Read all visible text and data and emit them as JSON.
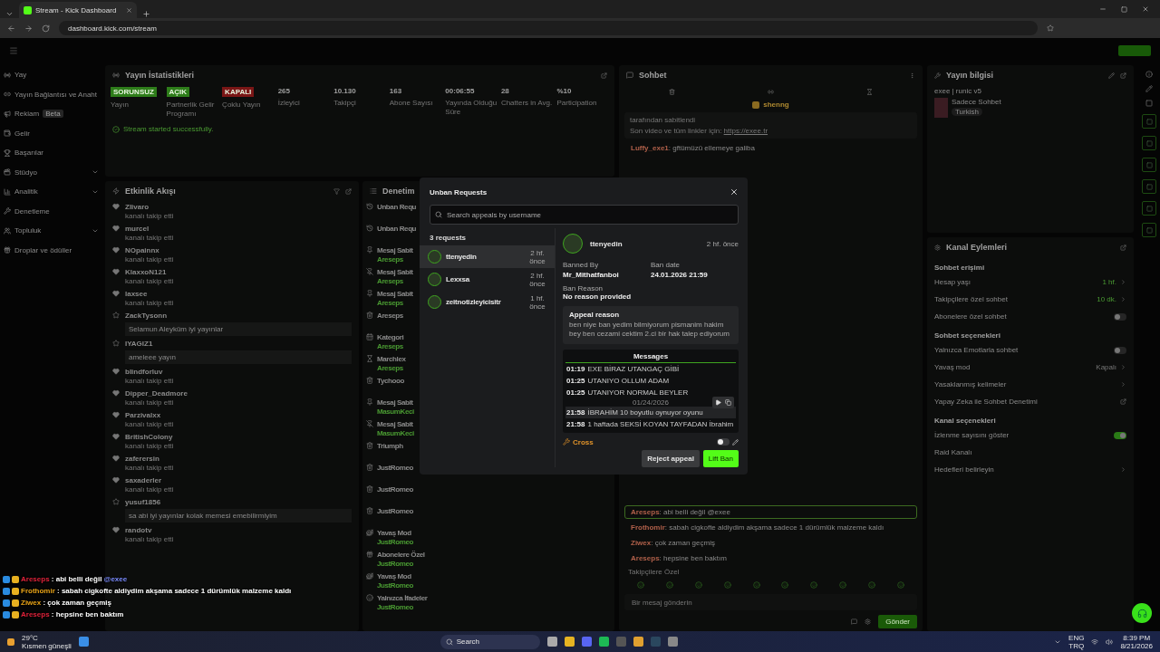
{
  "browser": {
    "tab_title": "Stream - Kick Dashboard",
    "url": "dashboard.kick.com/stream"
  },
  "sidebar": {
    "items": [
      {
        "label": "Yay",
        "submenu": false
      },
      {
        "label": "Yayın Bağlantısı ve Anaht",
        "submenu": false
      },
      {
        "label": "Rekiam",
        "badge": "Beta",
        "submenu": false
      },
      {
        "label": "Gelir",
        "submenu": false
      },
      {
        "label": "Başarılar",
        "submenu": false
      },
      {
        "label": "Stüdyo",
        "submenu": true
      },
      {
        "label": "Analitik",
        "submenu": true
      },
      {
        "label": "Denetleme",
        "submenu": false
      },
      {
        "label": "Topluluk",
        "submenu": true
      },
      {
        "label": "Droplar ve ödüller",
        "submenu": false
      }
    ]
  },
  "stats": {
    "title": "Yayın İstatistikleri",
    "items": [
      {
        "kind": "status",
        "value": "SORUNSUZ",
        "label": "Yayın",
        "color": "#2e7d1a"
      },
      {
        "kind": "status",
        "value": "AÇIK",
        "label": "Partnerlik Gelir Programı",
        "color": "#2e7d1a"
      },
      {
        "kind": "status",
        "value": "KAPALI",
        "label": "Çoklu Yayın",
        "color": "#7a1616"
      },
      {
        "kind": "metric",
        "value": "265",
        "label": "İzleyici"
      },
      {
        "kind": "metric",
        "value": "10.130",
        "label": "Takipçi"
      },
      {
        "kind": "metric",
        "value": "163",
        "label": "Abone Sayısı"
      },
      {
        "kind": "metric",
        "value": "00:06:55",
        "label": "Yayında Olduğu Süre"
      },
      {
        "kind": "metric",
        "value": "28",
        "label": "Chatters in Avg."
      },
      {
        "kind": "metric",
        "value": "%10",
        "label": "Participation"
      }
    ],
    "notice": "Stream started successfully."
  },
  "activity": {
    "title": "Etkinlik Akışı",
    "items": [
      {
        "kind": "follow",
        "name": "Zlivaro",
        "note": "kanalı takip etti"
      },
      {
        "kind": "follow",
        "name": "murcel",
        "note": "kanalı takip etti"
      },
      {
        "kind": "follow",
        "name": "NOpainnx",
        "note": "kanalı takip etti"
      },
      {
        "kind": "follow",
        "name": "KlaxxoN121",
        "note": "kanalı takip etti"
      },
      {
        "kind": "follow",
        "name": "laxsee",
        "note": "kanalı takip etti"
      },
      {
        "kind": "sub",
        "name": "ZackTysonn",
        "message": "Selamun Aleyküm iyi yayınlar"
      },
      {
        "kind": "sub",
        "name": "IYAGIZ1",
        "message": "ameleee yayın"
      },
      {
        "kind": "follow",
        "name": "blindforluv",
        "note": "kanalı takip etti"
      },
      {
        "kind": "follow",
        "name": "Dipper_Deadmore",
        "note": "kanalı takip etti"
      },
      {
        "kind": "follow",
        "name": "Parzivalxx",
        "note": "kanalı takip etti"
      },
      {
        "kind": "follow",
        "name": "BritishColony",
        "note": "kanalı takip etti"
      },
      {
        "kind": "follow",
        "name": "zaferersin",
        "note": "kanalı takip etti"
      },
      {
        "kind": "follow",
        "name": "saxaderler",
        "note": "kanalı takip etti"
      },
      {
        "kind": "sub",
        "name": "yusuf1856",
        "message": "sa abi iyi yayınlar kolak memesi emebilirmiyim"
      },
      {
        "kind": "follow",
        "name": "randotv",
        "note": "kanalı takip etti"
      }
    ]
  },
  "moderation": {
    "title": "Denetim",
    "items": [
      {
        "kind": "unban",
        "title": "Unban Requ"
      },
      {
        "kind": "unban",
        "title": "Unban Requ"
      },
      {
        "kind": "pin",
        "title": "Mesaj Sabit",
        "user": "Areseps"
      },
      {
        "kind": "unpin",
        "title": "Mesaj Sabit",
        "user": "Areseps"
      },
      {
        "kind": "pin",
        "title": "Mesaj Sabit",
        "user": "Areseps"
      },
      {
        "kind": "delete",
        "title": "Areseps"
      },
      {
        "kind": "category",
        "title": "Kategori",
        "user": "Areseps"
      },
      {
        "kind": "timeout",
        "title": "Marchlex",
        "user": "Areseps"
      },
      {
        "kind": "delete",
        "title": "Tychooo"
      },
      {
        "kind": "pin",
        "title": "Mesaj Sabit",
        "user": "MasumKeci"
      },
      {
        "kind": "unpin",
        "title": "Mesaj Sabit",
        "user": "MasumKeci"
      },
      {
        "kind": "delete",
        "title": "Triumph"
      },
      {
        "kind": "delete",
        "title": "JustRomeo"
      },
      {
        "kind": "delete",
        "title": "JustRomeo"
      },
      {
        "kind": "delete",
        "title": "JustRomeo"
      },
      {
        "kind": "slow",
        "title": "Yavaş Mod",
        "user": "JustRomeo"
      },
      {
        "kind": "subs",
        "title": "Abonelere Özel",
        "user": "JustRomeo"
      },
      {
        "kind": "slow",
        "title": "Yavaş Mod",
        "user": "JustRomeo"
      },
      {
        "kind": "emotes",
        "title": "Yalnızca İfadeler",
        "user": "JustRomeo"
      }
    ]
  },
  "chat": {
    "title": "Sohbet",
    "pinned_user": "shenng",
    "pinned_note": "tarafından sabitlendi",
    "pinned_text": "Son video ve tüm linkler için: ",
    "pinned_link": "https://exee.tr",
    "top_messages": [
      {
        "user": "Luffy_exe1",
        "text": ": gftümüzü ellemeye galiba"
      }
    ],
    "messages": [
      {
        "user": "Areseps",
        "text": ": abi belli değil @exee",
        "highlighted": true
      },
      {
        "user": "Frothomir",
        "text": ": sabah cigkofte aldiydim akşama sadece 1 dürümlük malzeme kaldı",
        "highlighted": false
      },
      {
        "user": "Ziwex",
        "text": ": çok zaman geçmiş",
        "highlighted": false
      },
      {
        "user": "Areseps",
        "text": ": hepsine ben baktım",
        "highlighted": false
      }
    ],
    "mode_note": "Takipçilere Özel",
    "placeholder": "Bir mesaj gönderin",
    "send": "Gönder"
  },
  "stream_info": {
    "title": "Yayın bilgisi",
    "stream_title": "exee | runic v5",
    "category": "Sadece Sohbet",
    "language": "Turkish"
  },
  "channel_actions": {
    "title": "Kanal Eylemleri",
    "sections": [
      {
        "title": "Sohbet erişimi",
        "rows": [
          {
            "kind": "value",
            "label": "Hesap yaşı",
            "value": "1 hf."
          },
          {
            "kind": "value",
            "label": "Takipçilere özel sohbet",
            "value": "10 dk."
          },
          {
            "kind": "toggle",
            "label": "Abonelere özel sohbet",
            "on": false
          }
        ]
      },
      {
        "title": "Sohbet seçenekleri",
        "rows": [
          {
            "kind": "toggle",
            "label": "Yalnızca Emotlarla sohbet",
            "on": false
          },
          {
            "kind": "muted",
            "label": "Yavaş mod",
            "value": "Kapalı"
          },
          {
            "kind": "link",
            "label": "Yasaklanmış kelimeler"
          },
          {
            "kind": "external",
            "label": "Yapay Zeka ile Sohbet Denetimi"
          }
        ]
      },
      {
        "title": "Kanal seçenekleri",
        "rows": [
          {
            "kind": "toggle",
            "label": "İzlenme sayısını göster",
            "on": true
          },
          {
            "kind": "plain",
            "label": "Raid Kanalı"
          },
          {
            "kind": "link",
            "label": "Hedefleri belirleyin"
          }
        ]
      }
    ]
  },
  "overlay_chat": [
    {
      "user": "Areseps",
      "color": "#e0223a",
      "text": " : abi belli değil ",
      "mention": "@exee"
    },
    {
      "user": "Frothomir",
      "color": "#e8a317",
      "text": " : sabah cigkofte aldiydim akşama sadece 1 dürümlük malzeme kaldı"
    },
    {
      "user": "Ziwex",
      "color": "#e8a317",
      "text": " : çok zaman geçmiş"
    },
    {
      "user": "Areseps",
      "color": "#e0223a",
      "text": " : hepsine ben baktım"
    }
  ],
  "modal": {
    "title": "Unban Requests",
    "search_placeholder": "Search appeals by username",
    "count": "3 requests",
    "requests": [
      {
        "name": "ttenyedin",
        "time": "2 hf. önce",
        "selected": true
      },
      {
        "name": "Lexxsa",
        "time": "2 hf. önce",
        "selected": false
      },
      {
        "name": "zeitnotizleyicisitr",
        "time": "1 hf. önce",
        "selected": false
      }
    ],
    "detail": {
      "name": "ttenyedin",
      "time": "2 hf. önce",
      "banned_by_label": "Banned By",
      "banned_by": "Mr_Mithatfanboi",
      "ban_date_label": "Ban date",
      "ban_date": "24.01.2026 21:59",
      "reason_label": "Ban Reason",
      "reason": "No reason provided",
      "appeal_label": "Appeal reason",
      "appeal": "ben niye ban yedim bilmiyorum pismanim hakim bey ben cezami cektim 2.ci bir hak talep ediyorum",
      "messages_tab": "Messages",
      "messages": [
        {
          "kind": "message",
          "time": "01:19",
          "text": "EXE BİRAZ UTANGAÇ GİBİ",
          "hovered": false
        },
        {
          "kind": "message",
          "time": "01:25",
          "text": "UTANIYO OLLUM ADAM",
          "hovered": false
        },
        {
          "kind": "message",
          "time": "01:25",
          "text": "UTANIYOR NORMAL BEYLER",
          "hovered": false
        },
        {
          "kind": "date",
          "text": "01/24/2026"
        },
        {
          "kind": "message",
          "time": "21:58",
          "text": "İBRAHİM 10 boyutlu oynuyor oyunu",
          "hovered": true
        },
        {
          "kind": "message",
          "time": "21:58",
          "text": "1 haftada SEKSİ KOYAN TAYFADAN İbrahim",
          "hovered": false
        }
      ],
      "moderator_label": "Cross",
      "toggle_on": false
    },
    "reject": "Reject appeal",
    "lift": "Lift Ban"
  },
  "taskbar": {
    "temperature": "29°C",
    "weather": "Kısmen güneşli",
    "search": "Search",
    "lang": "ENG",
    "layout": "TRQ",
    "time": "8:39 PM",
    "date": "8/21/2026"
  }
}
